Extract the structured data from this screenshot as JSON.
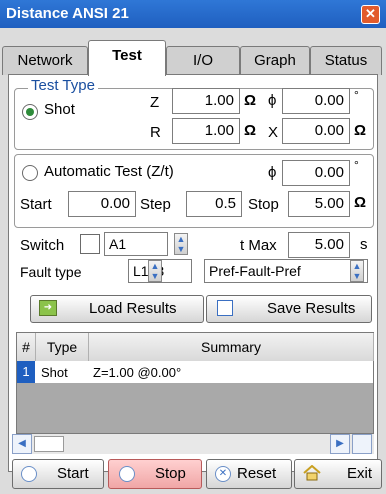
{
  "window": {
    "title": "Distance ANSI 21",
    "close_glyph": "✕"
  },
  "tabs": [
    {
      "label": "Network"
    },
    {
      "label": "Test"
    },
    {
      "label": "I/O"
    },
    {
      "label": "Graph"
    },
    {
      "label": "Status"
    }
  ],
  "test_type": {
    "legend": "Test Type",
    "shot_label": "Shot",
    "shot_selected": true,
    "z_label": "Z",
    "z_value": "1.00",
    "z_unit": "Ω",
    "phi_label": "ϕ",
    "phi_value": "0.00",
    "phi_unit": "°",
    "r_label": "R",
    "r_value": "1.00",
    "r_unit": "Ω",
    "x_label": "X",
    "x_value": "0.00",
    "x_unit": "Ω"
  },
  "auto_test": {
    "label": "Automatic Test (Z/t)",
    "phi_label": "ϕ",
    "phi_value": "0.00",
    "phi_unit": "°",
    "start_label": "Start",
    "start_value": "0.00",
    "step_label": "Step",
    "step_value": "0.5",
    "stop_label": "Stop",
    "stop_value": "5.00",
    "stop_unit": "Ω"
  },
  "switch": {
    "label": "Switch",
    "select_value": "A1",
    "tmax_label": "t Max",
    "tmax_value": "5.00",
    "tmax_unit": "s"
  },
  "fault": {
    "label": "Fault type",
    "type_value": "L123",
    "sequence_value": "Pref-Fault-Pref"
  },
  "results": {
    "load_label": "Load Results",
    "save_label": "Save Results"
  },
  "table": {
    "headers": [
      "#",
      "Type",
      "Summary"
    ],
    "rows": [
      {
        "index": "1",
        "type": "Shot",
        "summary": "Z=1.00 @0.00°"
      }
    ]
  },
  "actions": {
    "start_label": "Start",
    "stop_label": "Stop",
    "reset_label": "Reset",
    "exit_label": "Exit"
  }
}
